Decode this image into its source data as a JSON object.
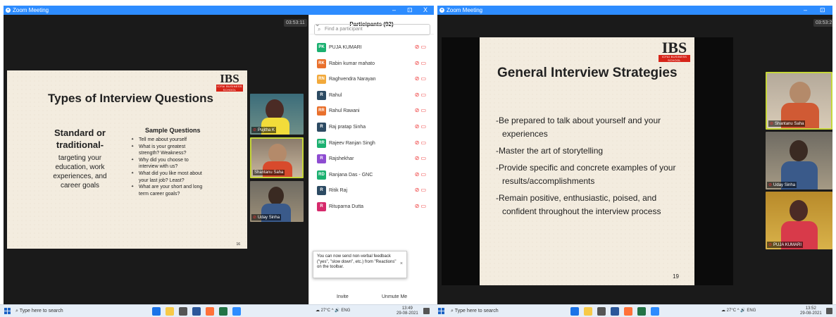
{
  "left_window": {
    "app_title": "Zoom Meeting",
    "window_controls": [
      "–",
      "⊡",
      "X"
    ],
    "timer": "03:53:11",
    "slide": {
      "title": "Types of Interview Questions",
      "logo": "IBS",
      "logo_band": "ICFAI BUSINESS SCHOOL",
      "left_heading_1": "Standard or",
      "left_heading_2": "traditional-",
      "left_body": [
        "targeting your",
        "education, work",
        "experiences, and",
        "career goals"
      ],
      "right_heading": "Sample Questions",
      "questions": [
        "Tell me about yourself",
        "What is your greatest",
        "strength? Weakness?",
        "Why did you choose to",
        "interview with us?",
        "What did you like most about",
        "your last job? Least?",
        "What are your short and long",
        "term career goals?"
      ],
      "page_number": "16"
    },
    "video_tiles": [
      {
        "name": "Pujitha K",
        "muted": true
      },
      {
        "name": "Shantanu Saha",
        "muted": false
      },
      {
        "name": "Uday Sinha",
        "muted": true
      }
    ],
    "participants_panel": {
      "title": "Participants (92)",
      "search_placeholder": "Find a participant",
      "participants": [
        {
          "initials": "PK",
          "name": "PUJA KUMARI",
          "color": "#1bb070"
        },
        {
          "initials": "RK",
          "name": "Rabin kumar mahato",
          "color": "#e9702c"
        },
        {
          "initials": "RN",
          "name": "Raghvendra Narayan",
          "color": "#f2a93b"
        },
        {
          "initials": "R",
          "name": "Rahul",
          "color": "#2d4b63"
        },
        {
          "initials": "RR",
          "name": "Rahul Rawani",
          "color": "#e9702c"
        },
        {
          "initials": "R",
          "name": "Raj pratap Sinha",
          "color": "#2d4b63"
        },
        {
          "initials": "RR",
          "name": "Rajeev Ranjan Singh",
          "color": "#1bb070"
        },
        {
          "initials": "R",
          "name": "Rajshekhar",
          "color": "#8e4cd1"
        },
        {
          "initials": "RD",
          "name": "Ranjana Das - GNC",
          "color": "#1bb070"
        },
        {
          "initials": "R",
          "name": "Ritik Raj",
          "color": "#2d4b63"
        },
        {
          "initials": "R",
          "name": "Rituparna Dutta",
          "color": "#d62a6c"
        }
      ],
      "toast": "You can now send non-verbal feedback (\"yes\", \"slow down\", etc.) from \"Reactions\" on the toolbar.",
      "invite_label": "Invite",
      "unmute_label": "Unmute Me"
    },
    "taskbar": {
      "search_placeholder": "Type here to search",
      "weather": "27°C",
      "lang": "ENG",
      "time": "13:49",
      "date": "29-08-2021"
    }
  },
  "right_window": {
    "app_title": "Zoom Meeting",
    "window_controls": [
      "–",
      "⊡"
    ],
    "timer": "03:53:2",
    "slide": {
      "title": "General Interview Strategies",
      "logo": "IBS",
      "logo_band": "ICFAI BUSINESS SCHOOL",
      "bullets": [
        [
          "-Be prepared to talk about yourself and your",
          "experiences"
        ],
        [
          "-Master the art of storytelling"
        ],
        [
          "-Provide specific and concrete examples of your",
          "results/accomplishments"
        ],
        [
          "-Remain positive, enthusiastic, poised, and",
          "confident throughout the interview process"
        ]
      ],
      "page_number": "19"
    },
    "video_tiles": [
      {
        "name": "Shantanu Saha",
        "muted": true
      },
      {
        "name": "Uday Sinha",
        "muted": true
      },
      {
        "name": "PUJA KUMARI",
        "muted": true
      }
    ],
    "taskbar": {
      "search_placeholder": "Type here to search",
      "weather": "27°C",
      "lang": "ENG",
      "time": "13:52",
      "date": "29-08-2021"
    }
  }
}
